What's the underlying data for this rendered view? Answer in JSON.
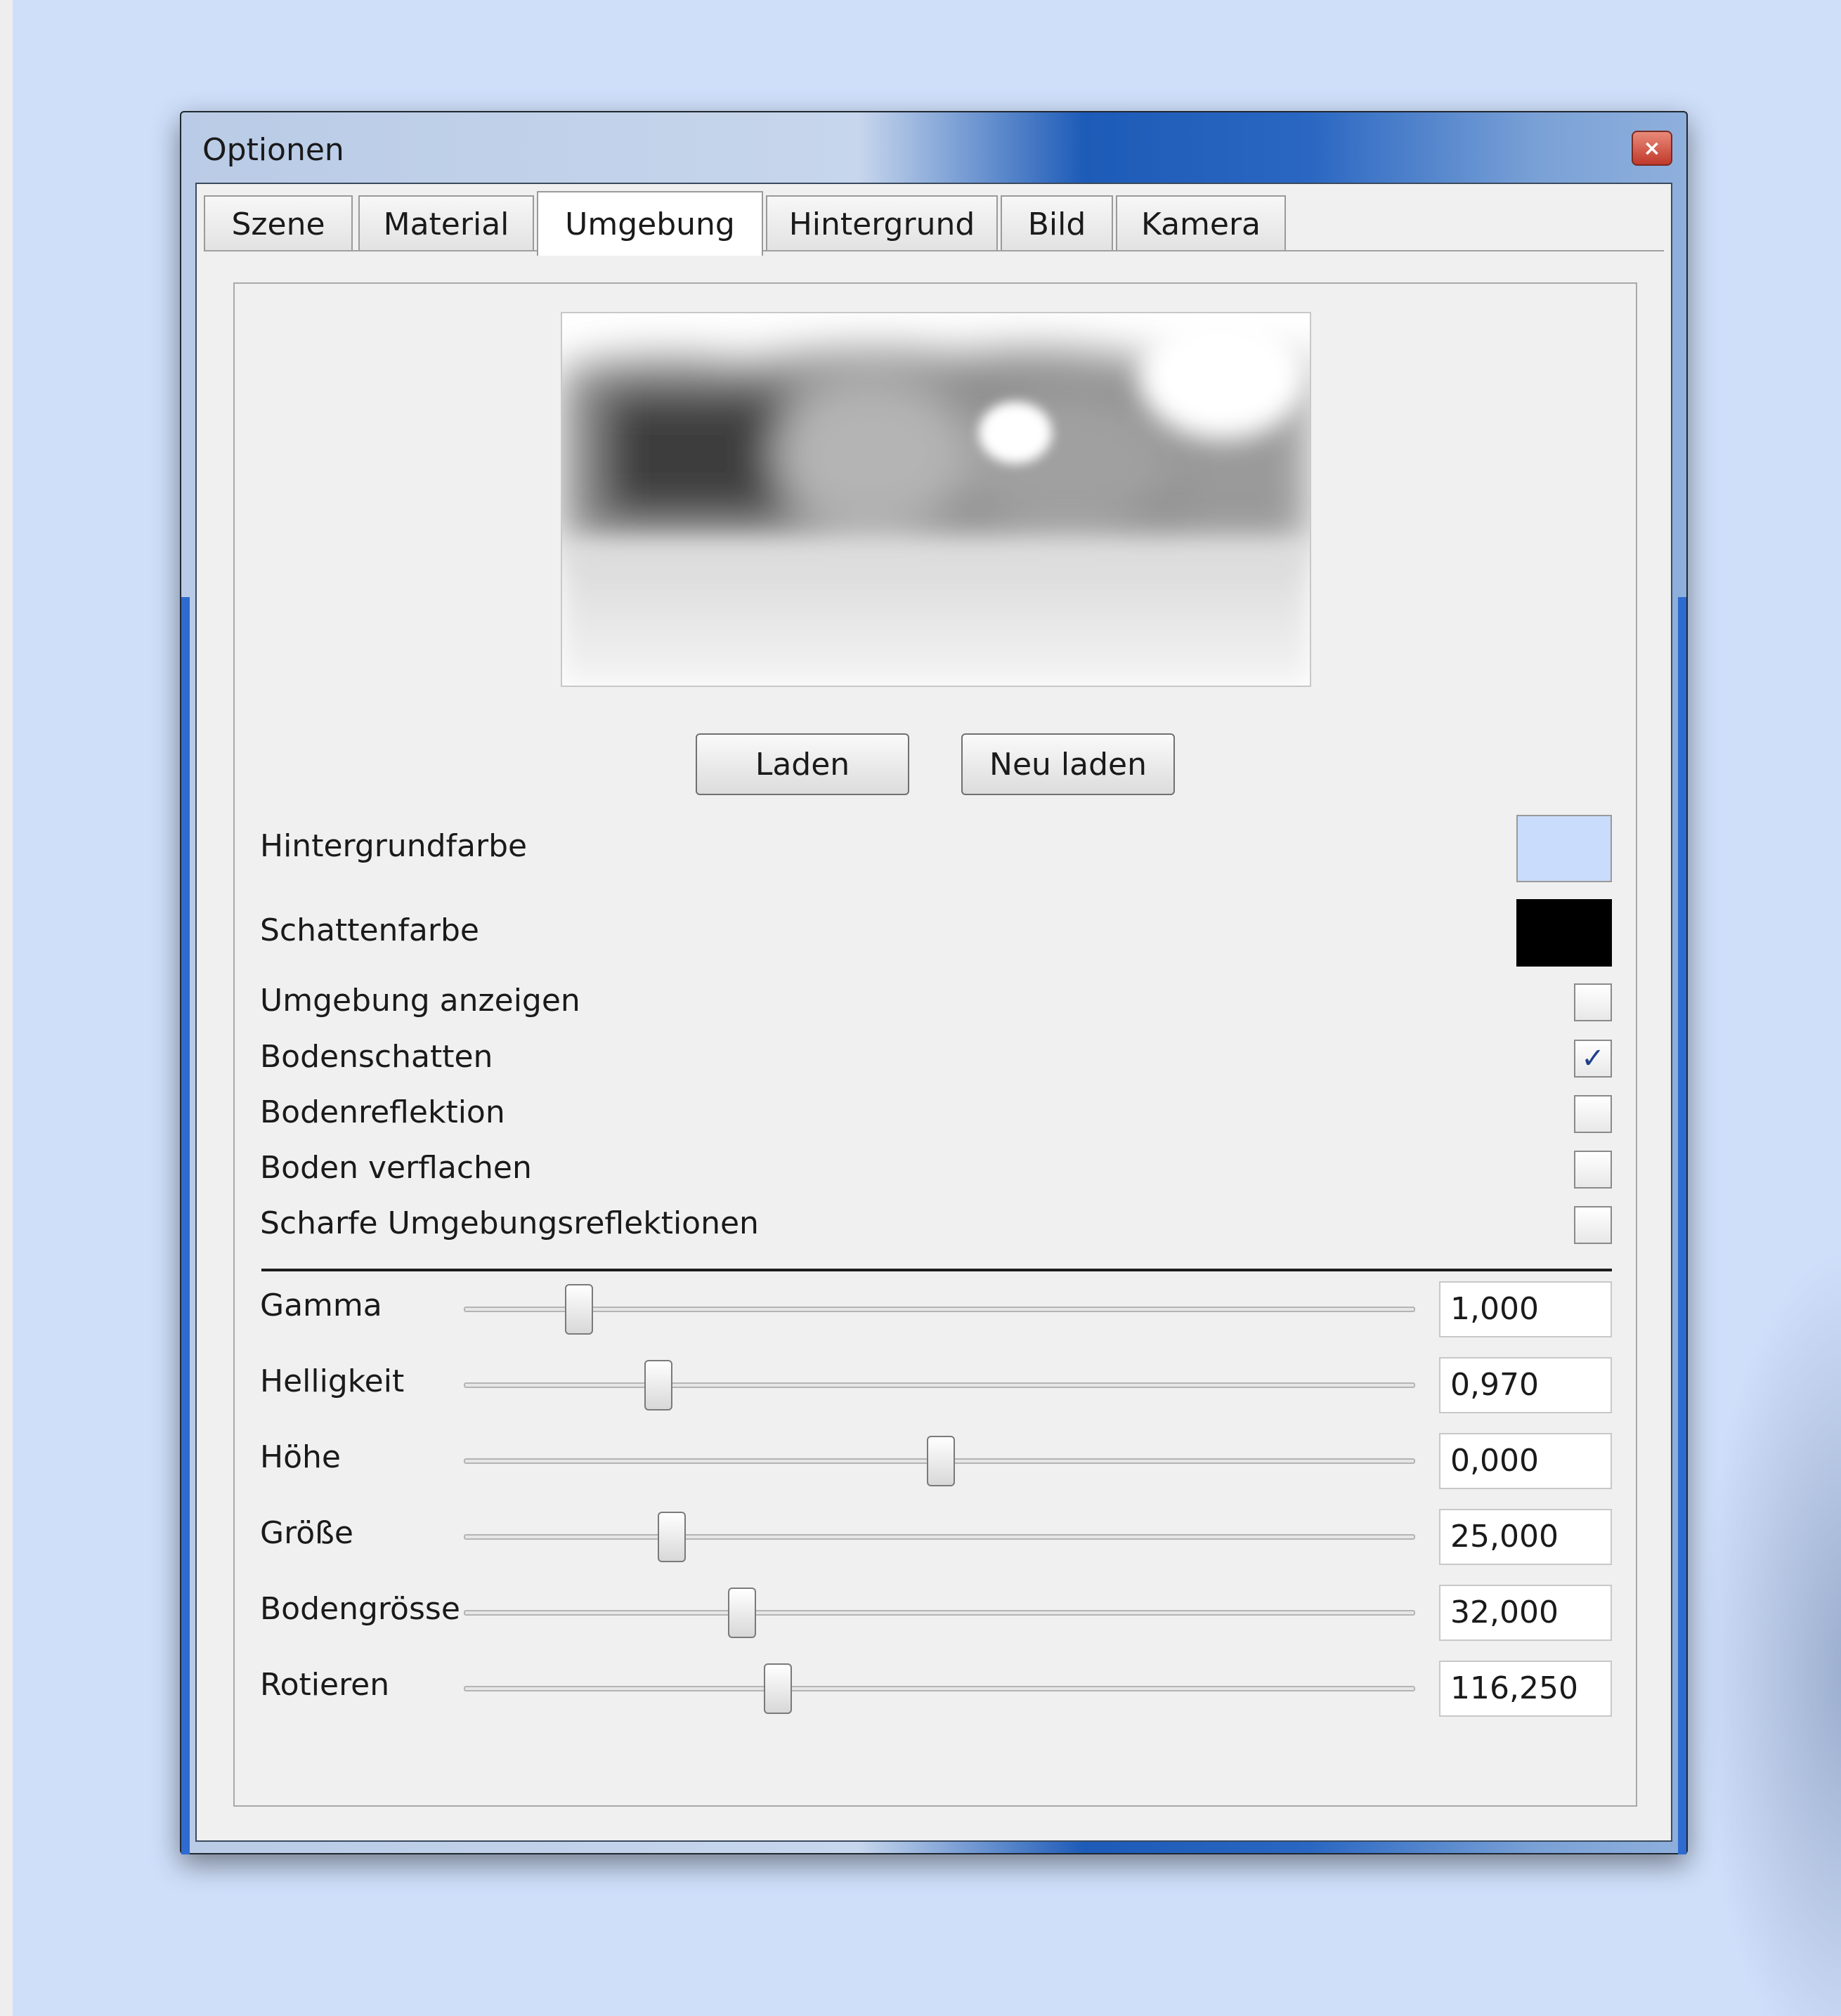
{
  "window": {
    "title": "Optionen",
    "close_glyph": "×"
  },
  "tabs": [
    {
      "label": "Szene"
    },
    {
      "label": "Material"
    },
    {
      "label": "Umgebung",
      "active": true
    },
    {
      "label": "Hintergrund"
    },
    {
      "label": "Bild"
    },
    {
      "label": "Kamera"
    }
  ],
  "buttons": {
    "load": "Laden",
    "reload": "Neu laden"
  },
  "colors": {
    "background_color_label": "Hintergrundfarbe",
    "background_color_value": "#c9dcfb",
    "shadow_color_label": "Schattenfarbe",
    "shadow_color_value": "#000000"
  },
  "checkboxes": [
    {
      "label": "Umgebung anzeigen",
      "checked": false
    },
    {
      "label": "Bodenschatten",
      "checked": true,
      "glyph": "✓"
    },
    {
      "label": "Bodenreflektion",
      "checked": false
    },
    {
      "label": "Boden verflachen",
      "checked": false
    },
    {
      "label": "Scharfe Umgebungsreflektionen",
      "checked": false
    }
  ],
  "sliders": [
    {
      "label": "Gamma",
      "value": "1,000",
      "position": 0.12
    },
    {
      "label": "Helligkeit",
      "value": "0,970",
      "position": 0.203
    },
    {
      "label": "Höhe",
      "value": "0,000",
      "position": 0.5
    },
    {
      "label": "Größe",
      "value": "25,000",
      "position": 0.217
    },
    {
      "label": "Bodengrösse",
      "value": "32,000",
      "position": 0.291
    },
    {
      "label": "Rotieren",
      "value": "116,250",
      "position": 0.329
    }
  ]
}
